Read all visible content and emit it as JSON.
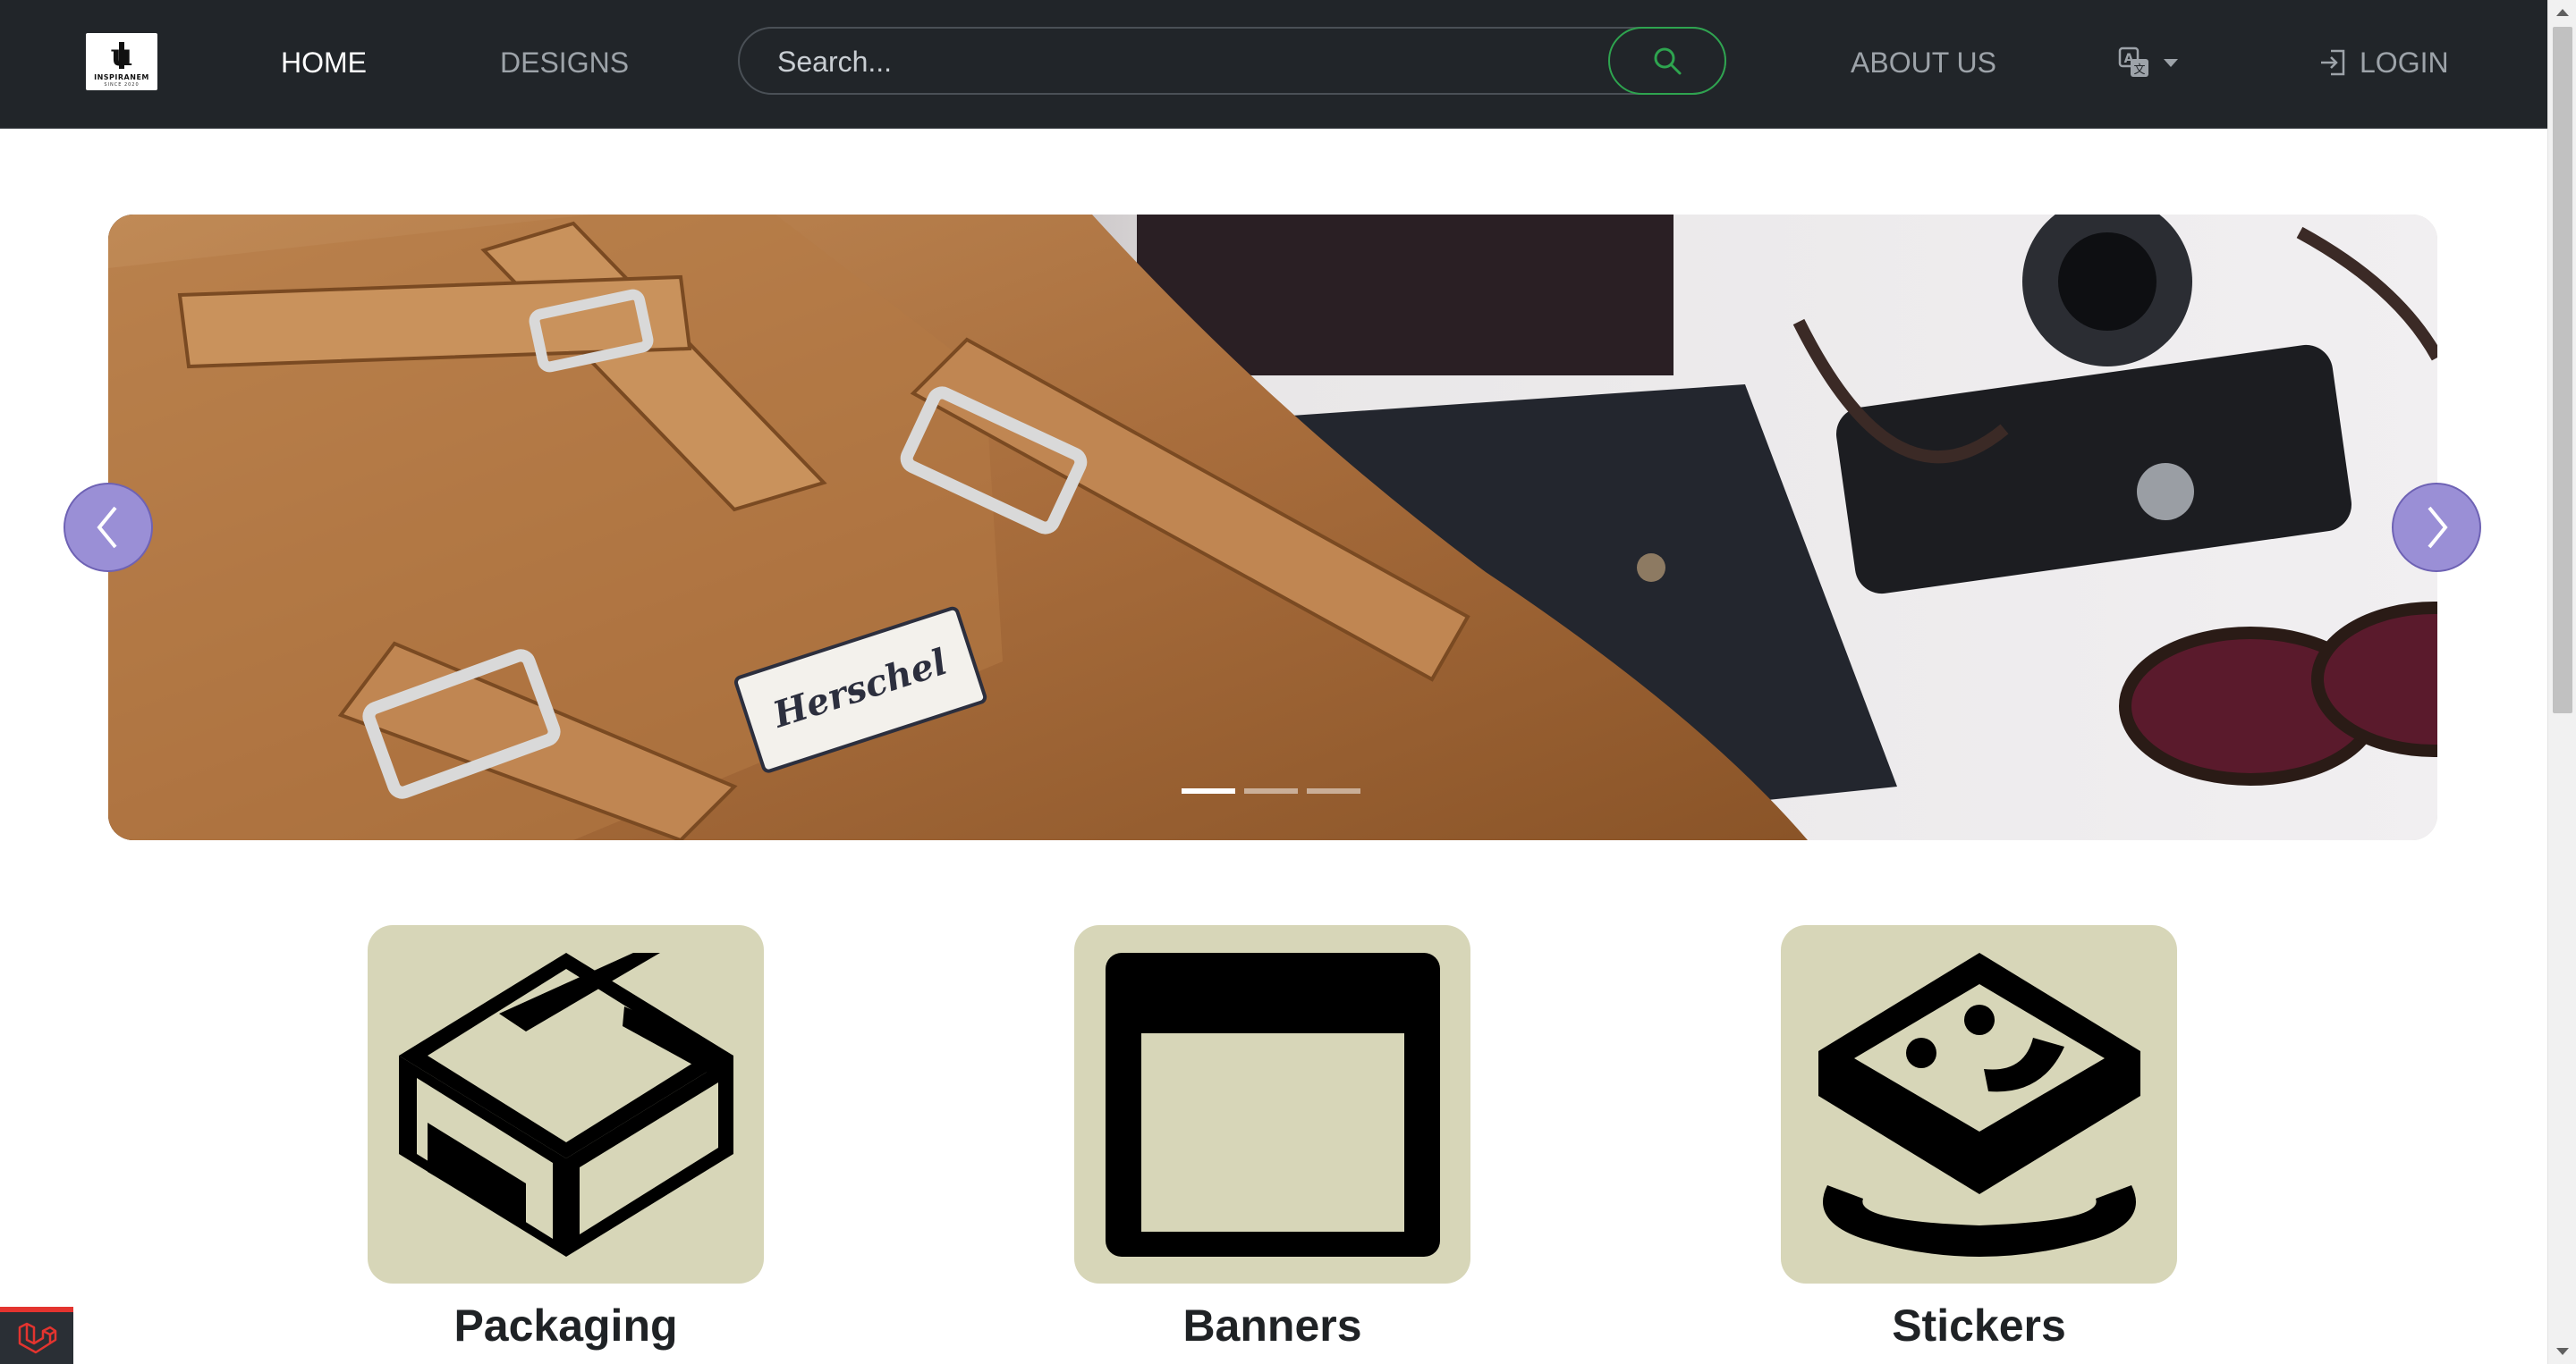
{
  "navbar": {
    "logo_text": "INSPIRANEM",
    "logo_sub": "SINCE 2020",
    "links": {
      "home": "HOME",
      "designs": "DESIGNS",
      "about": "ABOUT US",
      "login": "LOGIN"
    },
    "active_link": "home",
    "search": {
      "placeholder": "Search...",
      "value": ""
    },
    "language_icon": "translate-icon"
  },
  "carousel": {
    "slide_count": 3,
    "active_slide": 1,
    "prev_icon": "chevron-left-icon",
    "next_icon": "chevron-right-icon",
    "image_subject": "Herschel"
  },
  "categories": [
    {
      "label": "Packaging",
      "icon": "box-icon"
    },
    {
      "label": "Banners",
      "icon": "banner-icon"
    },
    {
      "label": "Stickers",
      "icon": "sticker-icon"
    }
  ],
  "colors": {
    "navbar_bg": "#212529",
    "nav_active": "#ffffff",
    "nav_inactive": "#9da3a9",
    "search_button_border": "#2ea44f",
    "carousel_control": "#9a8fd6",
    "category_card_bg": "#d7d6b8"
  }
}
